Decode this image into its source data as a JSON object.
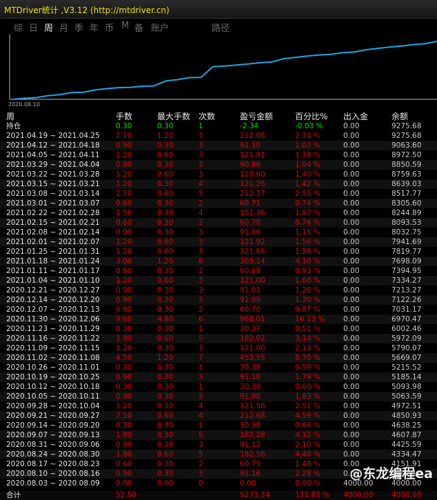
{
  "title": "MTDriver统计 ,V3.12 (http://mtdriver.cn)",
  "tabs": [
    "综",
    "日",
    "周",
    "月",
    "季",
    "年",
    "币",
    "M",
    "备",
    "账户",
    "路径"
  ],
  "active_tab": "周",
  "watermark": "@东龙编程ea",
  "colors": {
    "profit": "#e00000",
    "open": "#00e400",
    "line": "#1ea7e6"
  },
  "chart_data": {
    "type": "line",
    "x_start_label": "2020.08.10",
    "x": [
      "2020.08.03",
      "2020.08.10",
      "2020.08.17",
      "2020.08.24",
      "2020.08.31",
      "2020.09.07",
      "2020.09.14",
      "2020.09.21",
      "2020.09.28",
      "2020.10.05",
      "2020.10.12",
      "2020.10.19",
      "2020.10.26",
      "2020.11.02",
      "2020.11.09",
      "2020.11.16",
      "2020.11.23",
      "2020.11.30",
      "2020.12.07",
      "2020.12.14",
      "2020.12.21",
      "2021.01.04",
      "2021.01.11",
      "2021.01.18",
      "2021.01.25",
      "2021.02.01",
      "2021.02.08",
      "2021.02.15",
      "2021.02.22",
      "2021.03.01",
      "2021.03.08",
      "2021.03.15",
      "2021.03.22",
      "2021.03.29",
      "2021.04.05",
      "2021.04.12",
      "2021.04.19"
    ],
    "values": [
      4000.0,
      4091.16,
      4151.91,
      4334.47,
      4425.59,
      4607.87,
      4638.25,
      4850.93,
      4972.51,
      5063.59,
      5093.98,
      5185.14,
      5215.52,
      5669.07,
      5790.07,
      5972.09,
      6002.46,
      6970.47,
      7031.17,
      7122.26,
      7213.27,
      7334.27,
      7394.95,
      7698.09,
      7819.77,
      7941.69,
      8032.75,
      8093.53,
      8244.89,
      8305.6,
      8517.77,
      8639.03,
      8759.63,
      8850.59,
      8972.5,
      9063.6,
      9275.68
    ],
    "ylim": [
      4000,
      9400
    ]
  },
  "table": {
    "headers": [
      "周",
      "手数",
      "最大手数",
      "次数",
      "盈亏金额",
      "百分比%",
      "出入金",
      "余额"
    ],
    "position": {
      "label": "持仓",
      "lots": "0.30",
      "max_lots": "0.30",
      "count": "1",
      "pnl": "-2.34",
      "pct": "-0.03 %",
      "inout": "0.00",
      "balance": "9275.68"
    },
    "rows": [
      [
        "2021.04.19 ~ 2021.04.25",
        "2.10",
        "1.20",
        "3",
        "212.08",
        "2.34 %",
        "0.00",
        "9275.68"
      ],
      [
        "2021.04.12 ~ 2021.04.18",
        "0.90",
        "0.30",
        "3",
        "91.10",
        "1.02 %",
        "0.00",
        "9063.60"
      ],
      [
        "2021.04.05 ~ 2021.04.11",
        "1.20",
        "0.60",
        "3",
        "121.91",
        "1.38 %",
        "0.00",
        "8972.50"
      ],
      [
        "2021.03.29 ~ 2021.04.04",
        "0.90",
        "0.30",
        "3",
        "90.96",
        "1.04 %",
        "0.00",
        "8850.59"
      ],
      [
        "2021.03.22 ~ 2021.03.28",
        "1.20",
        "0.60",
        "3",
        "120.60",
        "1.40 %",
        "0.00",
        "8759.63"
      ],
      [
        "2021.03.15 ~ 2021.03.21",
        "1.20",
        "0.30",
        "4",
        "121.26",
        "1.42 %",
        "0.00",
        "8639.03"
      ],
      [
        "2021.03.08 ~ 2021.03.14",
        "2.10",
        "0.60",
        "5",
        "212.17",
        "2.55 %",
        "0.00",
        "8517.77"
      ],
      [
        "2021.03.01 ~ 2021.03.07",
        "0.60",
        "0.30",
        "2",
        "60.71",
        "0.74 %",
        "0.00",
        "8305.60"
      ],
      [
        "2021.02.22 ~ 2021.02.28",
        "1.50",
        "0.30",
        "4",
        "151.36",
        "1.87 %",
        "0.00",
        "8244.89"
      ],
      [
        "2021.02.15 ~ 2021.02.21",
        "0.60",
        "0.30",
        "2",
        "60.78",
        "0.76 %",
        "0.00",
        "8093.53"
      ],
      [
        "2021.02.08 ~ 2021.02.14",
        "0.90",
        "0.30",
        "3",
        "91.06",
        "1.15 %",
        "0.00",
        "8032.75"
      ],
      [
        "2021.02.01 ~ 2021.02.07",
        "1.20",
        "0.60",
        "3",
        "121.92",
        "1.56 %",
        "0.00",
        "7941.69"
      ],
      [
        "2021.01.25 ~ 2021.01.31",
        "1.20",
        "0.60",
        "3",
        "121.68",
        "1.58 %",
        "0.00",
        "7819.77"
      ],
      [
        "2021.01.18 ~ 2021.01.24",
        "3.00",
        "1.20",
        "6",
        "303.14",
        "4.10 %",
        "0.00",
        "7698.09"
      ],
      [
        "2021.01.11 ~ 2021.01.17",
        "0.60",
        "0.30",
        "2",
        "60.68",
        "0.83 %",
        "0.00",
        "7394.95"
      ],
      [
        "2021.01.04 ~ 2021.01.10",
        "1.20",
        "0.60",
        "3",
        "121.00",
        "1.68 %",
        "0.00",
        "7334.27"
      ],
      [
        "2020.12.21 ~ 2020.12.27",
        "0.90",
        "0.30",
        "3",
        "91.01",
        "1.28 %",
        "0.00",
        "7213.27"
      ],
      [
        "2020.12.14 ~ 2020.12.20",
        "0.90",
        "0.30",
        "3",
        "91.09",
        "1.30 %",
        "0.00",
        "7122.26"
      ],
      [
        "2020.12.07 ~ 2020.12.13",
        "0.60",
        "0.30",
        "2",
        "60.70",
        "0.87 %",
        "0.00",
        "7031.17"
      ],
      [
        "2020.11.30 ~ 2020.12.06",
        "9.60",
        "4.80",
        "6",
        "968.01",
        "16.13 %",
        "0.00",
        "6970.47"
      ],
      [
        "2020.11.23 ~ 2020.11.29",
        "0.30",
        "0.30",
        "1",
        "30.37",
        "0.51 %",
        "0.00",
        "6002.46"
      ],
      [
        "2020.11.16 ~ 2020.11.22",
        "1.80",
        "0.60",
        "5",
        "182.02",
        "3.14 %",
        "0.00",
        "5972.09"
      ],
      [
        "2020.11.09 ~ 2020.11.15",
        "1.20",
        "0.30",
        "3",
        "121.00",
        "2.13 %",
        "0.00",
        "5790.07"
      ],
      [
        "2020.11.02 ~ 2020.11.08",
        "4.50",
        "1.20",
        "7",
        "453.55",
        "8.70 %",
        "0.00",
        "5669.07"
      ],
      [
        "2020.10.26 ~ 2020.11.01",
        "0.30",
        "0.30",
        "1",
        "30.38",
        "0.59 %",
        "0.00",
        "5215.52"
      ],
      [
        "2020.10.19 ~ 2020.10.25",
        "0.90",
        "0.30",
        "3",
        "91.16",
        "1.79 %",
        "0.00",
        "5185.14"
      ],
      [
        "2020.10.12 ~ 2020.10.18",
        "0.30",
        "0.30",
        "1",
        "30.39",
        "0.60 %",
        "0.00",
        "5093.98"
      ],
      [
        "2020.10.05 ~ 2020.10.11",
        "0.90",
        "0.30",
        "3",
        "91.08",
        "1.83 %",
        "0.00",
        "5063.59"
      ],
      [
        "2020.09.28 ~ 2020.10.04",
        "1.20",
        "0.30",
        "4",
        "121.58",
        "2.51 %",
        "0.00",
        "4972.51"
      ],
      [
        "2020.09.21 ~ 2020.09.27",
        "2.10",
        "0.60",
        "4",
        "212.68",
        "4.59 %",
        "0.00",
        "4850.93"
      ],
      [
        "2020.09.14 ~ 2020.09.20",
        "0.30",
        "0.30",
        "1",
        "30.38",
        "0.66 %",
        "0.00",
        "4638.25"
      ],
      [
        "2020.09.07 ~ 2020.09.13",
        "1.80",
        "0.30",
        "5",
        "182.28",
        "4.12 %",
        "0.00",
        "4607.87"
      ],
      [
        "2020.08.31 ~ 2020.09.06",
        "0.90",
        "0.30",
        "3",
        "91.12",
        "2.10 %",
        "0.00",
        "4425.59"
      ],
      [
        "2020.08.24 ~ 2020.08.30",
        "1.80",
        "0.60",
        "5",
        "182.56",
        "4.40 %",
        "0.00",
        "4334.47"
      ],
      [
        "2020.08.17 ~ 2020.08.23",
        "0.60",
        "0.30",
        "2",
        "60.75",
        "1.48 %",
        "0.00",
        "4151.91"
      ],
      [
        "2020.08.10 ~ 2020.08.16",
        "0.90",
        "0.30",
        "3",
        "91.16",
        "2.28 %",
        "0.00",
        "4091.16"
      ],
      [
        "2020.08.03 ~ 2020.08.09",
        "0.00",
        "0.00",
        "0",
        "0.00",
        "0.00 %",
        "4000.00",
        "4000.00"
      ]
    ],
    "total": {
      "label": "合计",
      "lots": "52.50",
      "pnl": "5273.34",
      "pct": "131.83 %",
      "inout": "4000.00",
      "balance": "4000.00"
    }
  }
}
